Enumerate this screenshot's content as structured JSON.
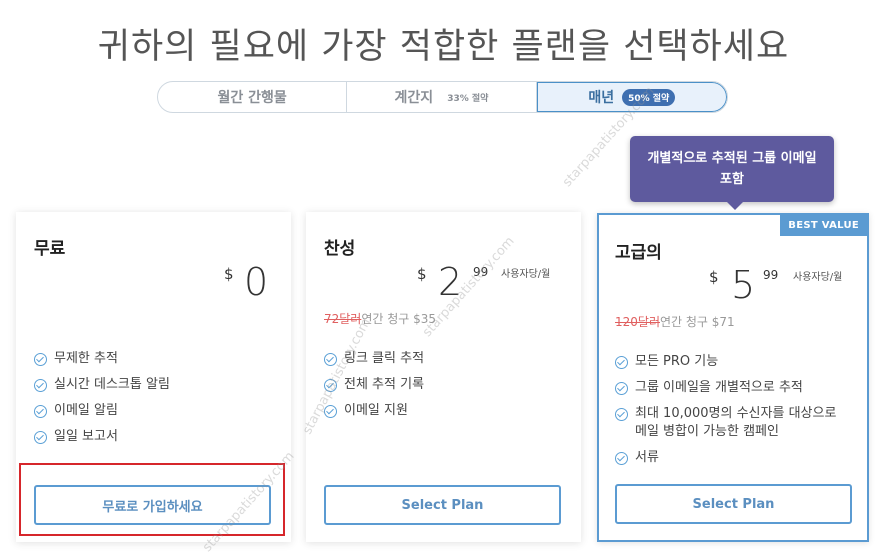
{
  "heading": "귀하의 필요에 가장 적합한 플랜을 선택하세요",
  "billing_toggle": {
    "options": [
      {
        "label": "월간 간행물",
        "save": ""
      },
      {
        "label": "계간지",
        "save": "33% 절약"
      },
      {
        "label": "매년",
        "save": "50% 절약"
      }
    ],
    "selected": "매년"
  },
  "tooltip": "개별적으로 추적된 그룹 이메일 포함",
  "plans": [
    {
      "name": "무료",
      "currency": "$",
      "amount": "0",
      "cents": "",
      "per": "",
      "old_price": "",
      "billing_note": "",
      "features": [
        "무제한 추적",
        "실시간 데스크톱 알림",
        "이메일 알림",
        "일일 보고서"
      ],
      "button": "무료로 가입하세요"
    },
    {
      "name": "찬성",
      "currency": "$",
      "amount": "2",
      "cents": "99",
      "per": "사용자당/월",
      "old_price": "72달러",
      "billing_note": "연간 청구 $35",
      "features": [
        "링크 클릭 추적",
        "전체 추적 기록",
        "이메일 지원"
      ],
      "button": "Select Plan"
    },
    {
      "name": "고급의",
      "currency": "$",
      "amount": "5",
      "cents": "99",
      "per": "사용자당/월",
      "old_price": "120달러",
      "billing_note": "연간 청구 $71",
      "badge": "BEST VALUE",
      "features": [
        "모든 PRO 기능",
        "그룹 이메일을 개별적으로 추적",
        "최대 10,000명의 수신자를 대상으로 메일 병합이 가능한 캠페인",
        "서류"
      ],
      "button": "Select Plan"
    }
  ],
  "watermark": "starpapatistory.com",
  "colors": {
    "accent": "#5b9bd2",
    "tooltip": "#5e5a9e",
    "highlight": "#d6262b",
    "strike": "#e06060"
  }
}
